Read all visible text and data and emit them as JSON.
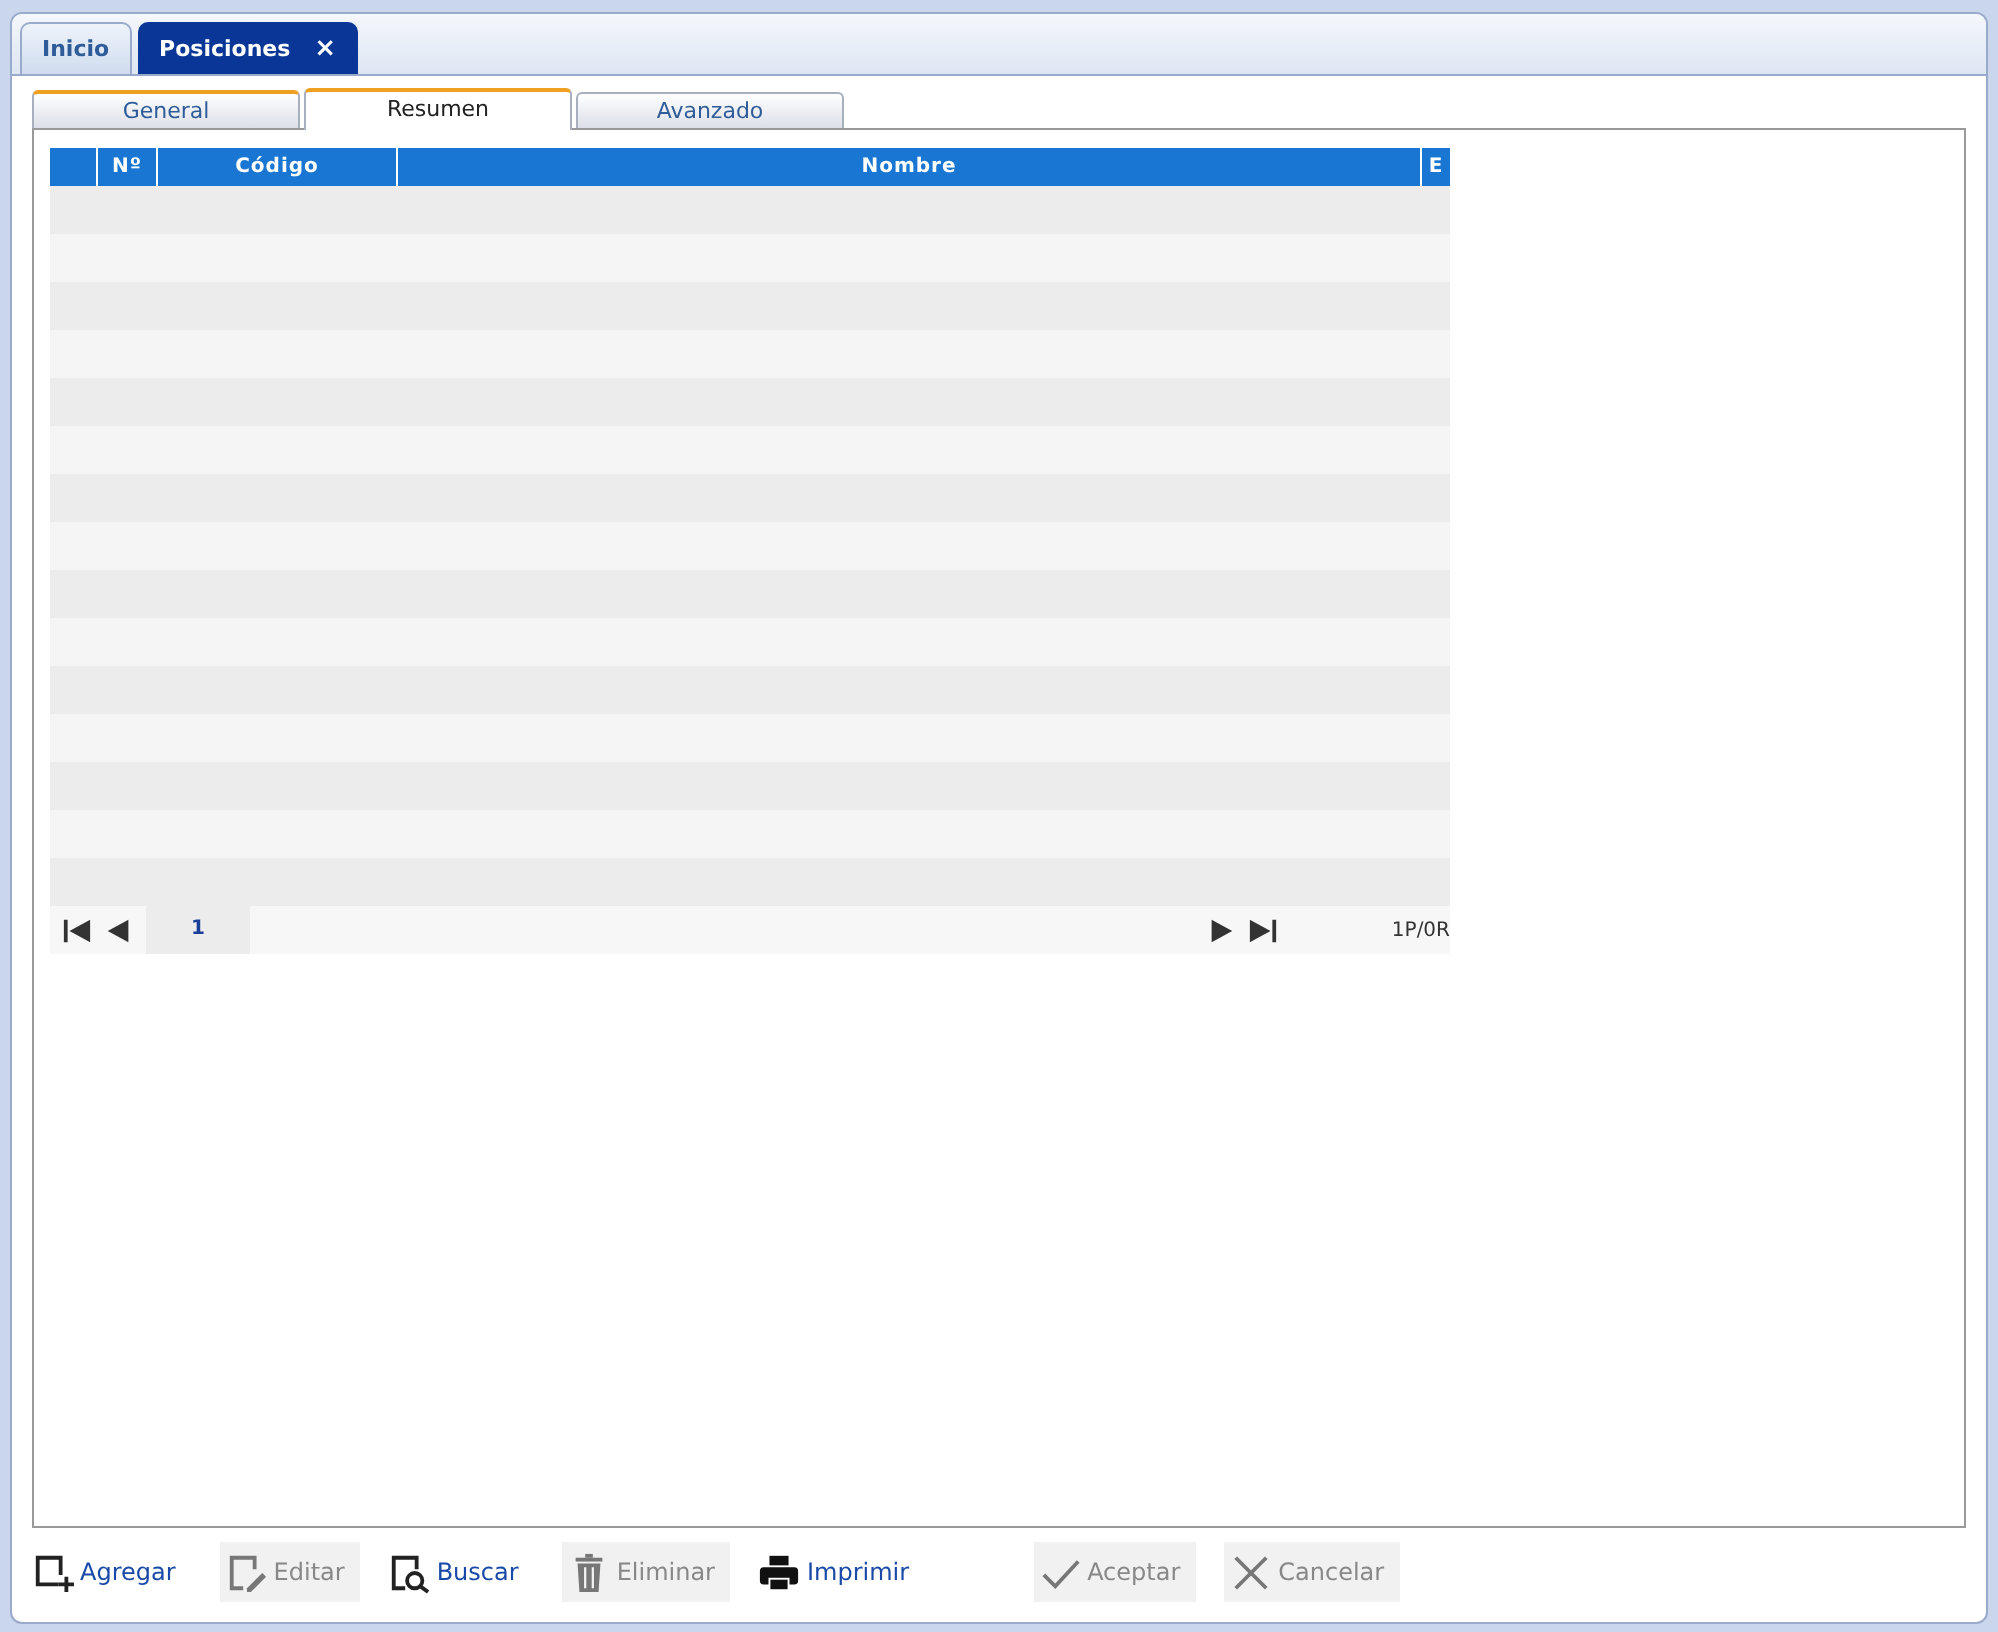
{
  "doc_tabs": [
    {
      "label": "Inicio",
      "selected": false
    },
    {
      "label": "Posiciones",
      "selected": true,
      "close_icon": "×"
    }
  ],
  "sub_tabs": [
    {
      "label": "General",
      "selected": false
    },
    {
      "label": "Resumen",
      "selected": true
    },
    {
      "label": "Avanzado",
      "selected": false
    }
  ],
  "table": {
    "columns": [
      "",
      "Nº",
      "Código",
      "Nombre",
      "E"
    ]
  },
  "pager": {
    "page": "1",
    "info": "1P/0R"
  },
  "toolbar": [
    {
      "label": "Agregar",
      "kind": "add",
      "disabled": false
    },
    {
      "label": "Editar",
      "kind": "edit",
      "disabled": true
    },
    {
      "label": "Buscar",
      "kind": "search",
      "disabled": false
    },
    {
      "label": "Eliminar",
      "kind": "delete",
      "disabled": true
    },
    {
      "label": "Imprimir",
      "kind": "print",
      "disabled": false
    },
    {
      "label": "Aceptar",
      "kind": "accept",
      "disabled": true
    },
    {
      "label": "Cancelar",
      "kind": "cancel",
      "disabled": true
    }
  ]
}
